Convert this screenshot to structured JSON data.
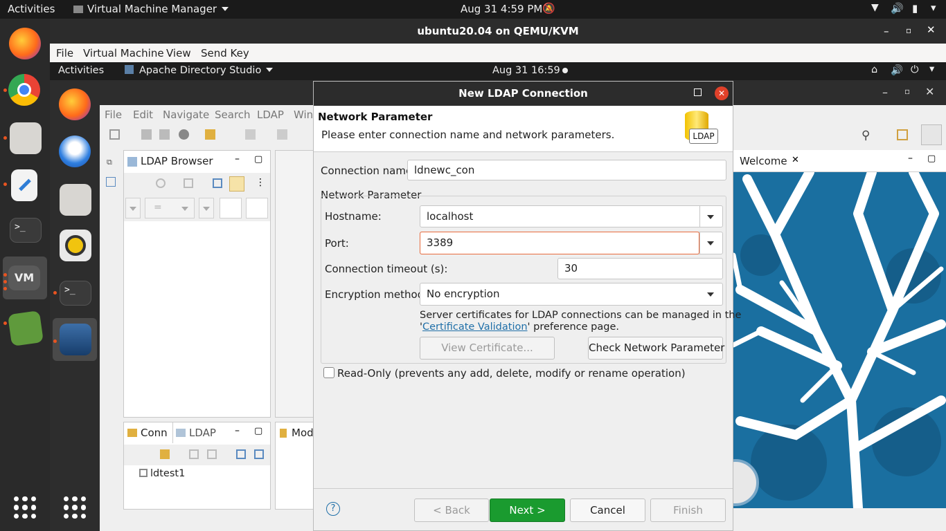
{
  "host": {
    "activities": "Activities",
    "app_name": "Virtual Machine Manager",
    "clock": "Aug 31  4:59 PM"
  },
  "vm": {
    "title": "ubuntu20.04 on QEMU/KVM",
    "menu": [
      "File",
      "Virtual Machine",
      "View",
      "Send Key"
    ]
  },
  "guest": {
    "activities": "Activities",
    "app_name": "Apache Directory Studio",
    "clock": "Aug 31  16:59"
  },
  "ads": {
    "menu": [
      "File",
      "Edit",
      "Navigate",
      "Search",
      "LDAP",
      "Win"
    ],
    "ldap_browser_tab": "LDAP Browser",
    "filter_value": "=",
    "conn_tab": "Conn",
    "ldap_tab": "LDAP",
    "mod_tab": "Mod",
    "connection_item": "ldtest1",
    "welcome_tab": "Welcome"
  },
  "dialog": {
    "title": "New LDAP Connection",
    "header_title": "Network Parameter",
    "header_desc": "Please enter connection name and network parameters.",
    "header_icon_text": "LDAP",
    "connection_name_label": "Connection name:",
    "connection_name_value": "ldnewc_con",
    "group_label": "Network Parameter",
    "hostname_label": "Hostname:",
    "hostname_value": "localhost",
    "port_label": "Port:",
    "port_value": "3389",
    "timeout_label": "Connection timeout (s):",
    "timeout_value": "30",
    "encryption_label": "Encryption method:",
    "encryption_value": "No encryption",
    "cert_note_1": "Server certificates for LDAP connections can be managed in the",
    "cert_note_quote_open": "'",
    "cert_link": "Certificate Validation",
    "cert_note_2": "' preference page.",
    "view_cert_button": "View Certificate...",
    "check_network_button": "Check Network Parameter",
    "readonly_label": "Read-Only (prevents any add, delete, modify or rename operation)",
    "back_button": "< Back",
    "next_button": "Next >",
    "cancel_button": "Cancel",
    "finish_button": "Finish",
    "help_icon": "?"
  },
  "colors": {
    "accent": "#e95420",
    "next_button": "#1a9b2f",
    "port_focus": "#e86a3c",
    "link": "#1f6fa8",
    "welcome_bg": "#1a6fa0"
  }
}
